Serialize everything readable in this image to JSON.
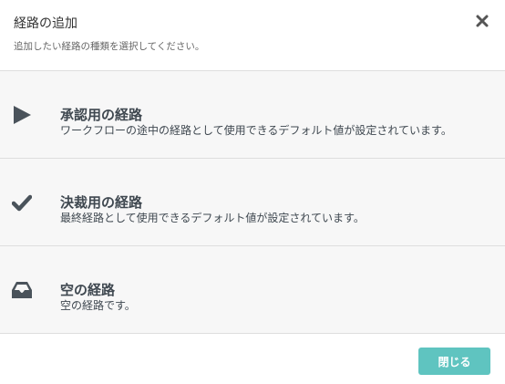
{
  "dialog": {
    "title": "経路の追加",
    "subtitle": "追加したい経路の種類を選択してください。",
    "close_icon": "close-icon"
  },
  "options": [
    {
      "icon": "play-triangle-icon",
      "title": "承認用の経路",
      "description": "ワークフローの途中の経路として使用できるデフォルト値が設定されています。"
    },
    {
      "icon": "checkmark-icon",
      "title": "決裁用の経路",
      "description": "最終経路として使用できるデフォルト値が設定されています。"
    },
    {
      "icon": "inbox-tray-icon",
      "title": "空の経路",
      "description": "空の経路です。"
    }
  ],
  "footer": {
    "close_label": "閉じる"
  },
  "colors": {
    "accent": "#5fc4c0",
    "option_bg": "#f7f7f7",
    "icon": "#4a535b",
    "text": "#3f4850",
    "divider": "#dedede"
  }
}
